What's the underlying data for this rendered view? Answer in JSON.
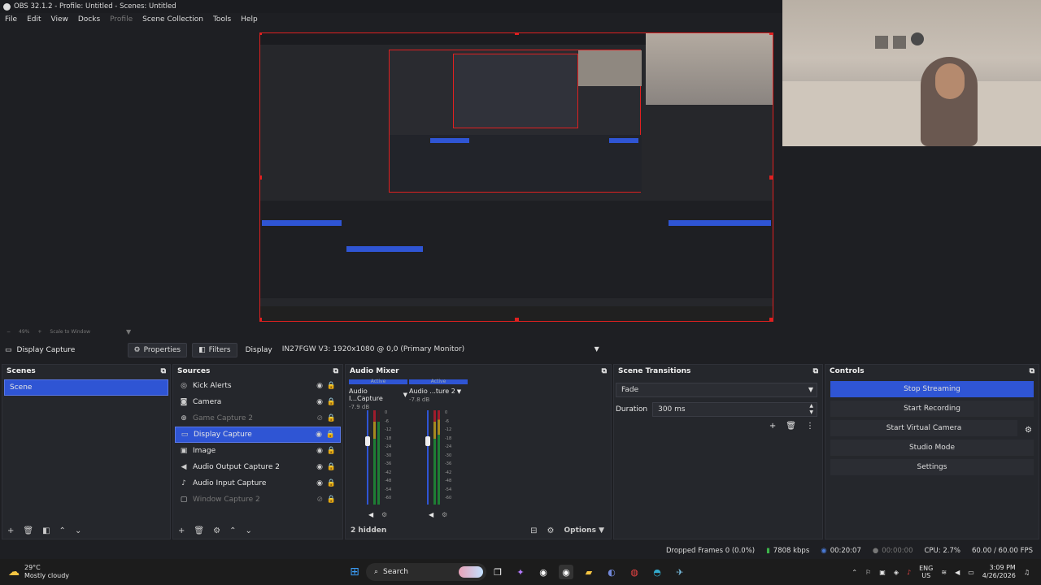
{
  "titlebar": {
    "title": "OBS 32.1.2 - Profile: Untitled - Scenes: Untitled"
  },
  "menu": [
    {
      "label": "File",
      "enabled": true
    },
    {
      "label": "Edit",
      "enabled": true
    },
    {
      "label": "View",
      "enabled": true
    },
    {
      "label": "Docks",
      "enabled": true
    },
    {
      "label": "Profile",
      "enabled": false
    },
    {
      "label": "Scene Collection",
      "enabled": true
    },
    {
      "label": "Tools",
      "enabled": true
    },
    {
      "label": "Help",
      "enabled": true
    }
  ],
  "zoombar": {
    "zoom": "49%",
    "scale": "Scale to Window"
  },
  "sourcebar": {
    "source_name": "Display Capture",
    "properties": "Properties",
    "filters": "Filters",
    "display_label": "Display",
    "display_value": "IN27FGW V3: 1920x1080 @ 0,0 (Primary Monitor)"
  },
  "scenes": {
    "title": "Scenes",
    "items": [
      "Scene"
    ]
  },
  "sources": {
    "title": "Sources",
    "items": [
      {
        "name": "Kick Alerts",
        "icon": "globe-icon",
        "visible": true
      },
      {
        "name": "Camera",
        "icon": "camera-icon",
        "visible": true
      },
      {
        "name": "Game Capture 2",
        "icon": "gamepad-icon",
        "visible": false
      },
      {
        "name": "Display Capture",
        "icon": "monitor-icon",
        "visible": true,
        "selected": true
      },
      {
        "name": "Image",
        "icon": "image-icon",
        "visible": true
      },
      {
        "name": "Audio Output Capture 2",
        "icon": "speaker-icon",
        "visible": true
      },
      {
        "name": "Audio Input Capture",
        "icon": "microphone-icon",
        "visible": true
      },
      {
        "name": "Window Capture 2",
        "icon": "window-icon",
        "visible": false
      }
    ]
  },
  "mixer": {
    "title": "Audio Mixer",
    "channels": [
      {
        "name": "Audio I...Capture",
        "db": "-7.9 dB",
        "status": "Active"
      },
      {
        "name": "Audio ...ture 2",
        "db": "-7.8 dB",
        "status": "Active"
      }
    ],
    "scale": [
      "0",
      "-6",
      "-12",
      "-18",
      "-24",
      "-30",
      "-36",
      "-42",
      "-48",
      "-54",
      "-60"
    ],
    "hidden": "2 hidden",
    "options": "Options"
  },
  "transitions": {
    "title": "Scene Transitions",
    "type": "Fade",
    "duration_label": "Duration",
    "duration_value": "300 ms"
  },
  "controls": {
    "title": "Controls",
    "buttons": [
      "Stop Streaming",
      "Start Recording",
      "Start Virtual Camera",
      "Studio Mode",
      "Settings"
    ]
  },
  "status": {
    "dropped": "Dropped Frames 0 (0.0%)",
    "bitrate": "7808 kbps",
    "stream_time": "00:20:07",
    "rec_time": "00:00:00",
    "cpu": "CPU: 2.7%",
    "fps": "60.00 / 60.00 FPS"
  },
  "taskbar": {
    "weather_temp": "29°C",
    "weather_desc": "Mostly cloudy",
    "search": "Search",
    "lang1": "ENG",
    "lang2": "US",
    "time": "3:09 PM",
    "date": "4/26/2026"
  },
  "colors": {
    "accent": "#2f55d4",
    "preview_border": "#e02020"
  }
}
